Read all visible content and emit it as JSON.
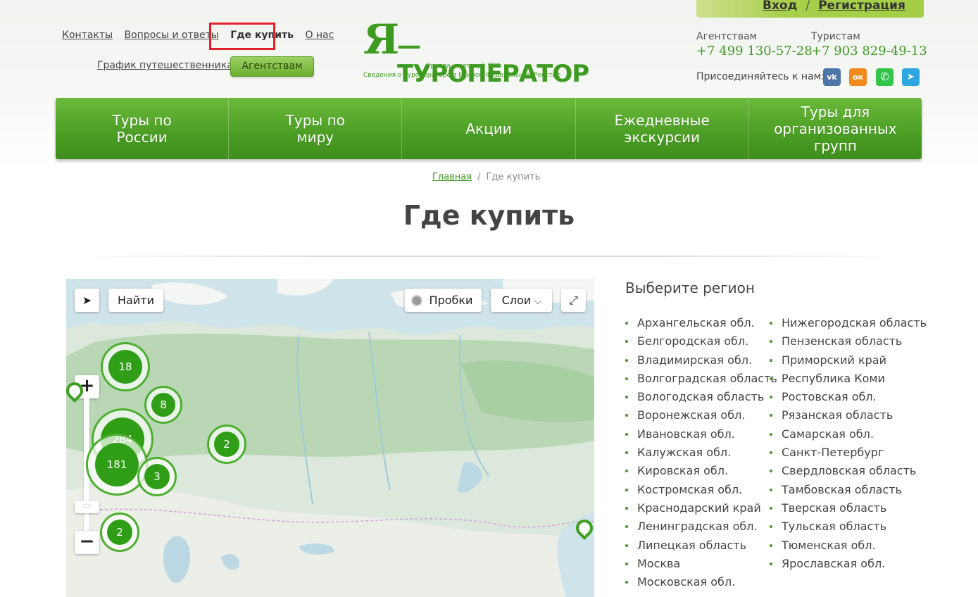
{
  "header": {
    "top_links": [
      "Контакты",
      "Вопросы и ответы",
      "Где купить",
      "О нас"
    ],
    "schedule_link": "График путешественника",
    "agents_button": "Агентствам",
    "logo": {
      "mark": "Я",
      "name": "—ТУРОПЕРАТОР",
      "sub1": "Группа компаний ЯТО",
      "sub2": "Сведения о Туроператоре в Едином Федеральном Реестре"
    },
    "auth": {
      "login": "Вход",
      "separator": "/",
      "register": "Регистрация"
    },
    "contacts": {
      "agents_label": "Агентствам",
      "agents_phone": "+7 499 130-57-28",
      "tourists_label": "Туристам",
      "tourists_phone": "+7 903 829-49-13"
    },
    "join_label": "Присоединяйтесь к нам:",
    "social": [
      {
        "name": "vk-icon",
        "glyph": "vk",
        "color": "#4a76a8"
      },
      {
        "name": "ok-icon",
        "glyph": "ок",
        "color": "#f08a1c"
      },
      {
        "name": "whatsapp-icon",
        "glyph": "✆",
        "color": "#34c44a"
      },
      {
        "name": "telegram-icon",
        "glyph": "➤",
        "color": "#2ea6e0"
      }
    ]
  },
  "nav": [
    "Туры по\nРоссии",
    "Туры по\nмиру",
    "Акции",
    "Ежедневные\nэкскурсии",
    "Туры для\nорганизованных групп"
  ],
  "breadcrumb": {
    "home": "Главная",
    "separator": "/",
    "current": "Где купить"
  },
  "page_title": "Где купить",
  "map": {
    "find_button": "Найти",
    "traffic_button": "Пробки",
    "layers_button": "Слои",
    "zoom_in": "+",
    "zoom_out": "−",
    "clusters": [
      {
        "label": "18"
      },
      {
        "label": "8"
      },
      {
        "label": "284"
      },
      {
        "label": "181"
      },
      {
        "label": "3"
      },
      {
        "label": "2"
      },
      {
        "label": "2"
      }
    ]
  },
  "regions": {
    "title": "Выберите регион",
    "col1": [
      "Архангельская обл.",
      "Белгородская обл.",
      "Владимирская обл.",
      "Волгоградская область",
      "Вологодская область",
      "Воронежская обл.",
      "Ивановская обл.",
      "Калужская обл.",
      "Кировская обл.",
      "Костромская обл.",
      "Краснодарский край",
      "Ленинградская обл.",
      "Липецкая область",
      "Москва",
      "Московская обл."
    ],
    "col2": [
      "Нижегородская область",
      "Пензенская область",
      "Приморский край",
      "Республика Коми",
      "Ростовская обл.",
      "Рязанская область",
      "Самарская обл.",
      "Санкт-Петербург",
      "Свердловская область",
      "Тамбовская область",
      "Тверская область",
      "Тульская область",
      "Тюменская обл.",
      "Ярославская обл."
    ]
  }
}
